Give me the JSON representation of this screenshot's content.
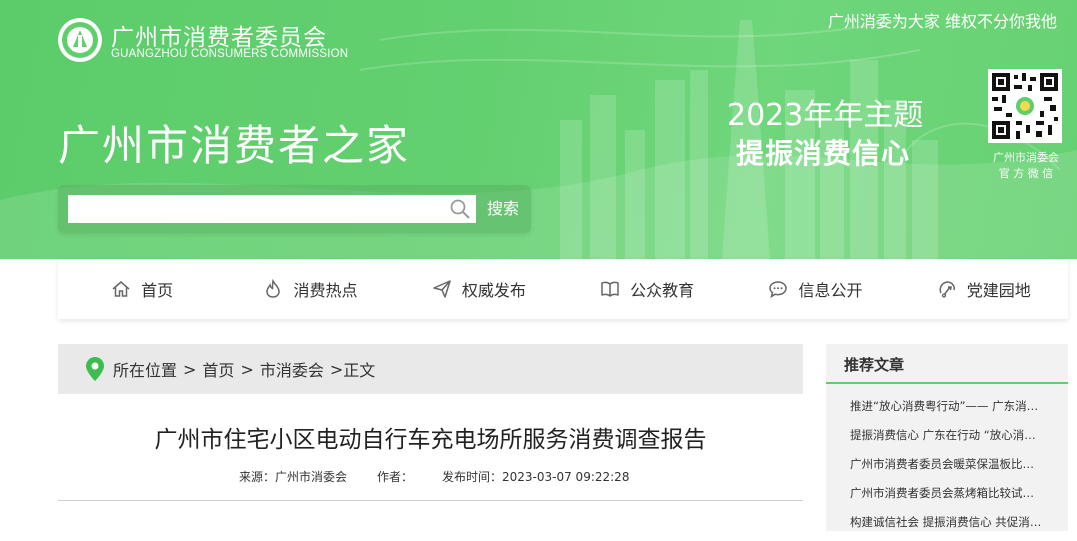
{
  "header": {
    "org_name_cn": "广州市消费者委员会",
    "org_name_en": "GUANGZHOU CONSUMERS COMMISSION",
    "slogan": "广州消委为大家 维权不分你我他",
    "site_title": "广州市消费者之家",
    "theme_year": "2023年年主题",
    "theme_line": "提振消费信心",
    "qr_caption_line1": "广州市消委会",
    "qr_caption_line2": "官 方 微 信"
  },
  "search": {
    "placeholder": "",
    "value": "",
    "button_label": "搜索"
  },
  "nav": {
    "items": [
      {
        "label": "首页",
        "icon": "home-icon"
      },
      {
        "label": "消费热点",
        "icon": "flame-icon"
      },
      {
        "label": "权威发布",
        "icon": "send-icon"
      },
      {
        "label": "公众教育",
        "icon": "book-icon"
      },
      {
        "label": "信息公开",
        "icon": "chat-icon"
      },
      {
        "label": "党建园地",
        "icon": "party-icon"
      }
    ]
  },
  "breadcrumb": {
    "prefix": "所在位置",
    "items": [
      "首页",
      "市消委会",
      "正文"
    ],
    "separator": ">"
  },
  "article": {
    "title": "广州市住宅小区电动自行车充电场所服务消费调查报告",
    "source": "来源：广州市消委会",
    "author": "作者：",
    "published": "发布时间：2023-03-07 09:22:28"
  },
  "sidebar": {
    "heading": "推荐文章",
    "items": [
      "推进“放心消费粤行动”—— 广东消委会系统持续开展放心消费活动",
      "提振消费信心 广东在行动 “放心消费粤行动”",
      "广州市消费者委员会暖菜保温板比较试验报告",
      "广州市消费者委员会蒸烤箱比较试验报告",
      "构建诚信社会 提振消费信心 共促消费公平"
    ]
  },
  "colors": {
    "banner_green": "#63d070",
    "accent_green": "#5fcf6c",
    "breadcrumb_bg": "#e9e9e9",
    "sidebar_bg": "#f2f2f2"
  }
}
